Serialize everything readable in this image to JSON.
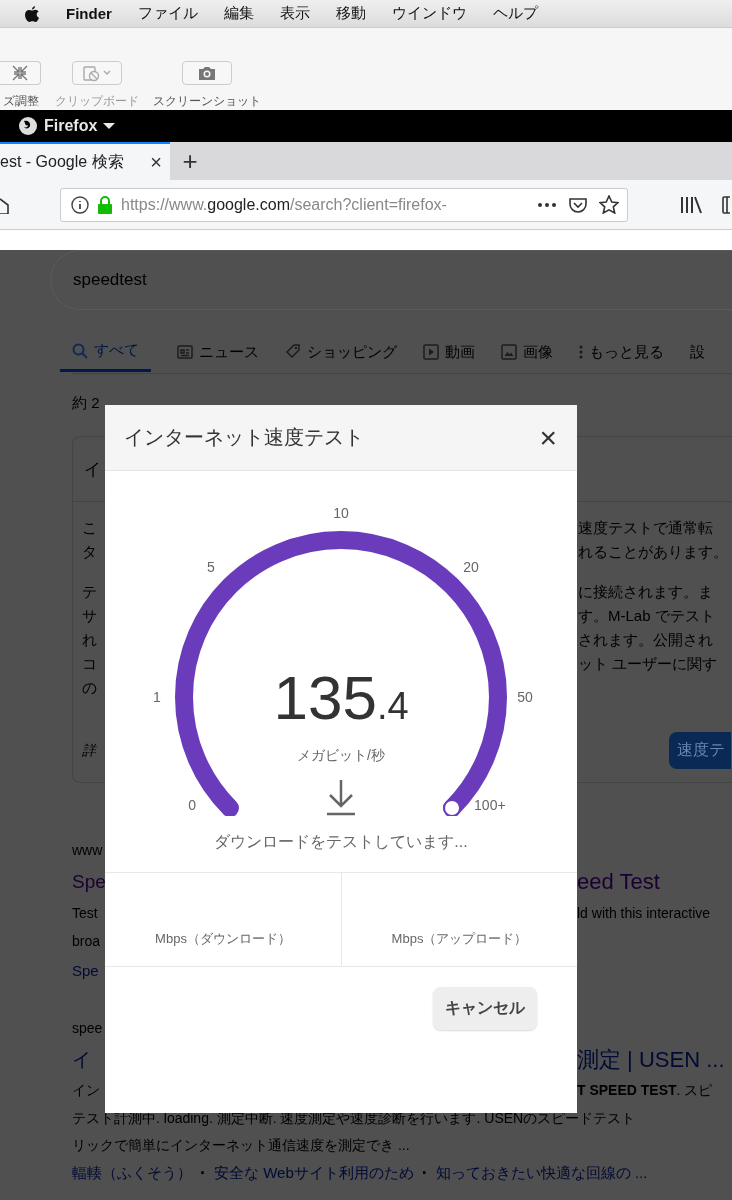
{
  "menu_bar": {
    "app": "Finder",
    "items": [
      "ファイル",
      "編集",
      "表示",
      "移動",
      "ウインドウ",
      "ヘルプ"
    ]
  },
  "toolbar": {
    "items": [
      {
        "label": "ズ調整",
        "kind": "shrink",
        "disabled": false
      },
      {
        "label": "クリップボード",
        "kind": "clipboard",
        "disabled": true
      },
      {
        "label": "スクリーンショット",
        "kind": "camera",
        "disabled": false
      }
    ]
  },
  "app_bar": {
    "title": "Firefox"
  },
  "browser_tabs": [
    {
      "label": "est - Google 検索",
      "close": "×",
      "selected": true
    }
  ],
  "new_tab": "+",
  "address_bar": {
    "url_prefix": "https://www.",
    "url_domain": "google.com",
    "url_path": "/search?client=firefox-"
  },
  "page": {
    "query": "speedtest",
    "tabs": [
      {
        "label": "すべて",
        "kind": "search",
        "selected": true
      },
      {
        "label": "ニュース",
        "kind": "news",
        "selected": false
      },
      {
        "label": "ショッピング",
        "kind": "tag",
        "selected": false
      },
      {
        "label": "動画",
        "kind": "video",
        "selected": false
      },
      {
        "label": "画像",
        "kind": "image",
        "selected": false
      },
      {
        "label": "もっと見る",
        "kind": "more",
        "selected": false
      },
      {
        "label": "設",
        "kind": "text",
        "selected": false
      }
    ],
    "result_count": "約 2",
    "card": {
      "header": "イ",
      "paragraphs": [
        [
          {
            "left": "こ",
            "right": "速度テストで通常転"
          },
          {
            "left": "タ",
            "right": "れることがあります。"
          }
        ],
        [
          {
            "left": "テ",
            "right": "に接続されます。ま"
          },
          {
            "left": "サ",
            "right": "す。M-Lab でテスト"
          },
          {
            "left": "れ",
            "right": "されます。公開され"
          },
          {
            "left": "コ",
            "right": "ット ユーザーに関す"
          },
          {
            "left": "の"
          }
        ]
      ],
      "footer_left": "詳",
      "button": "速度テ"
    },
    "results": [
      {
        "kind": "url",
        "left": "www"
      },
      {
        "kind": "title_visited",
        "left": "Spe",
        "right": "eed Test"
      },
      {
        "kind": "snippet",
        "left": "Test",
        "right": "ld with this interactive"
      },
      {
        "kind": "snippet",
        "left": "broa"
      },
      {
        "kind": "link",
        "left": "Spe"
      },
      {
        "kind": "gap"
      },
      {
        "kind": "url",
        "left": "spee"
      },
      {
        "kind": "title",
        "left": "イ",
        "right": "測定 | USEN ..."
      },
      {
        "kind": "snippet",
        "left": "イン",
        "right": "**T SPEED TEST**. スピ"
      }
    ],
    "snippet_lines": [
      "テスト計測中. loading. 測定中断. 速度測定や速度診断を行います. USENのスピードテスト",
      "リックで簡単にインターネット通信速度を測定でき ..."
    ],
    "separator": "·",
    "sitelinks": [
      "輻輳（ふくそう）",
      "安全な Webサイト利用のため",
      "知っておきたい快適な回線の ..."
    ]
  },
  "dialog": {
    "title": "インターネット速度テスト",
    "close": "×",
    "gauge": {
      "level": 1,
      "ticks": [
        "0",
        "1",
        "5",
        "10",
        "20",
        "50",
        "100+"
      ],
      "value_integer": "135",
      "value_fraction": ".4",
      "unit": "メガビット/秒"
    },
    "status": "ダウンロードをテストしています...",
    "results": [
      {
        "label": "Mbps（ダウンロード）"
      },
      {
        "label": "Mbps（アップロード）"
      }
    ],
    "cancel": "キャンセル"
  }
}
